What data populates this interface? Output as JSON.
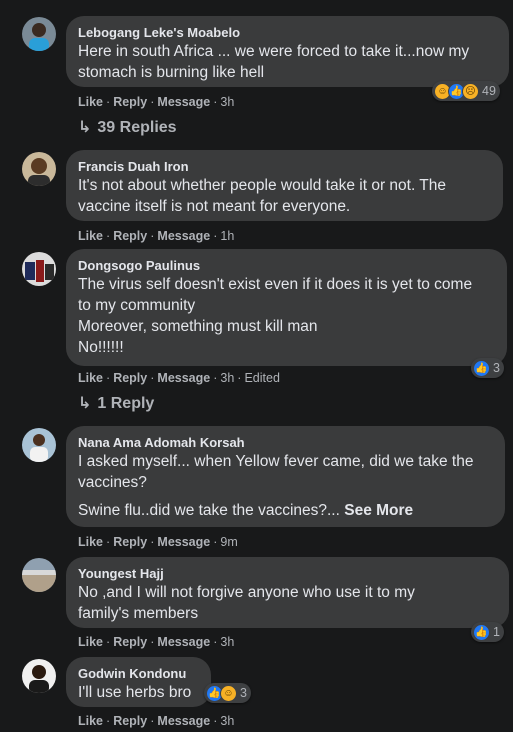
{
  "comments": [
    {
      "author": "Lebogang Leke's Moabelo",
      "lines": [
        "Here in south Africa ... we were forced to take it...now my",
        "stomach is burning like hell"
      ],
      "actions": {
        "like": "Like",
        "reply": "Reply",
        "message": "Message",
        "time": "3h",
        "edited": ""
      },
      "reactions": {
        "icons": [
          "haha-icon",
          "like-icon",
          "sad-icon"
        ],
        "count": "49"
      },
      "replies": "39 Replies"
    },
    {
      "author": "Francis Duah Iron",
      "lines": [
        "It's not about whether people would take it or not. The",
        "vaccine itself is not meant for everyone."
      ],
      "actions": {
        "like": "Like",
        "reply": "Reply",
        "message": "Message",
        "time": "1h",
        "edited": ""
      }
    },
    {
      "author": "Dongsogo Paulinus",
      "lines": [
        "The virus self doesn't exist even if it does it is yet to come",
        "to my community",
        "Moreover, something must kill man",
        "No!!!!!!"
      ],
      "actions": {
        "like": "Like",
        "reply": "Reply",
        "message": "Message",
        "time": "3h",
        "edited": "Edited"
      },
      "reactions": {
        "icons": [
          "like-icon"
        ],
        "count": "3"
      },
      "replies": "1 Reply"
    },
    {
      "author": "Nana Ama Adomah Korsah",
      "lines": [
        "I asked myself... when Yellow fever came, did we take the",
        "vaccines?"
      ],
      "lines2": "Swine flu..did we take the vaccines?...",
      "see_more": "See More",
      "actions": {
        "like": "Like",
        "reply": "Reply",
        "message": "Message",
        "time": "9m",
        "edited": ""
      }
    },
    {
      "author": "Youngest Hajj",
      "lines": [
        "No ,and I will not forgive anyone who use it to my",
        "family's members"
      ],
      "actions": {
        "like": "Like",
        "reply": "Reply",
        "message": "Message",
        "time": "3h",
        "edited": ""
      },
      "reactions": {
        "icons": [
          "like-icon"
        ],
        "count": "1"
      }
    },
    {
      "author": "Godwin Kondonu",
      "lines": [
        "I'll use herbs bro"
      ],
      "actions": {
        "like": "Like",
        "reply": "Reply",
        "message": "Message",
        "time": "3h",
        "edited": ""
      },
      "reactions": {
        "icons": [
          "like-icon",
          "haha-icon"
        ],
        "count": "3"
      }
    }
  ],
  "colors": {
    "background": "#18191a",
    "bubble": "#3a3b3c",
    "secondary_text": "#b0b3b8",
    "like_blue": "#2078f4",
    "emoji_yellow": "#f7b125"
  }
}
